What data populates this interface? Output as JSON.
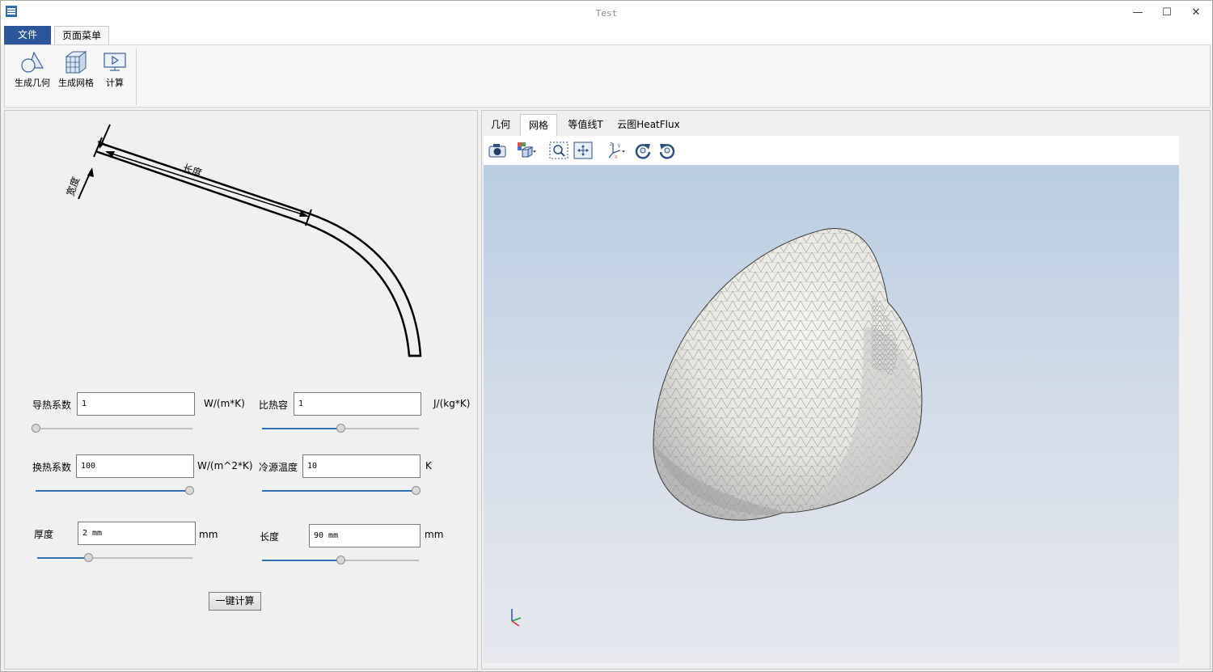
{
  "window": {
    "title": "Test",
    "minimize": "—",
    "maximize": "☐",
    "close": "✕"
  },
  "ribbon_tabs": {
    "file": "文件",
    "page_menu": "页面菜单"
  },
  "ribbon": {
    "gen_geometry": "生成几何",
    "gen_mesh": "生成网格",
    "compute": "计算"
  },
  "diagram": {
    "length_label": "长度",
    "width_label": "宽度"
  },
  "params": {
    "conductivity": {
      "label": "导热系数",
      "value": "1",
      "unit": "W/(m*K)",
      "slider": 0.0
    },
    "specific_heat": {
      "label": "比热容",
      "value": "1",
      "unit": "J/(kg*K)",
      "slider": 0.5
    },
    "heat_transfer": {
      "label": "换热系数",
      "value": "100",
      "unit": "W/(m^2*K)",
      "slider": 1.0
    },
    "cold_temp": {
      "label": "冷源温度",
      "value": "10",
      "unit": "K",
      "slider": 1.0
    },
    "thickness": {
      "label": "厚度",
      "value": "2 mm",
      "unit": "mm",
      "slider": 0.33
    },
    "length": {
      "label": "长度",
      "value": "90 mm",
      "unit": "mm",
      "slider": 0.5
    }
  },
  "one_click_button": "一键计算",
  "view_tabs": [
    "几何",
    "网格",
    "等值线T",
    "云图HeatFlux"
  ],
  "active_view_tab": "网格",
  "colors": {
    "accent": "#2b579a",
    "slider_fill": "#2f70b8",
    "viewport_top": "#b9cde3",
    "viewport_bottom": "#e6e8ee",
    "mesh": "#e8e6e0"
  }
}
